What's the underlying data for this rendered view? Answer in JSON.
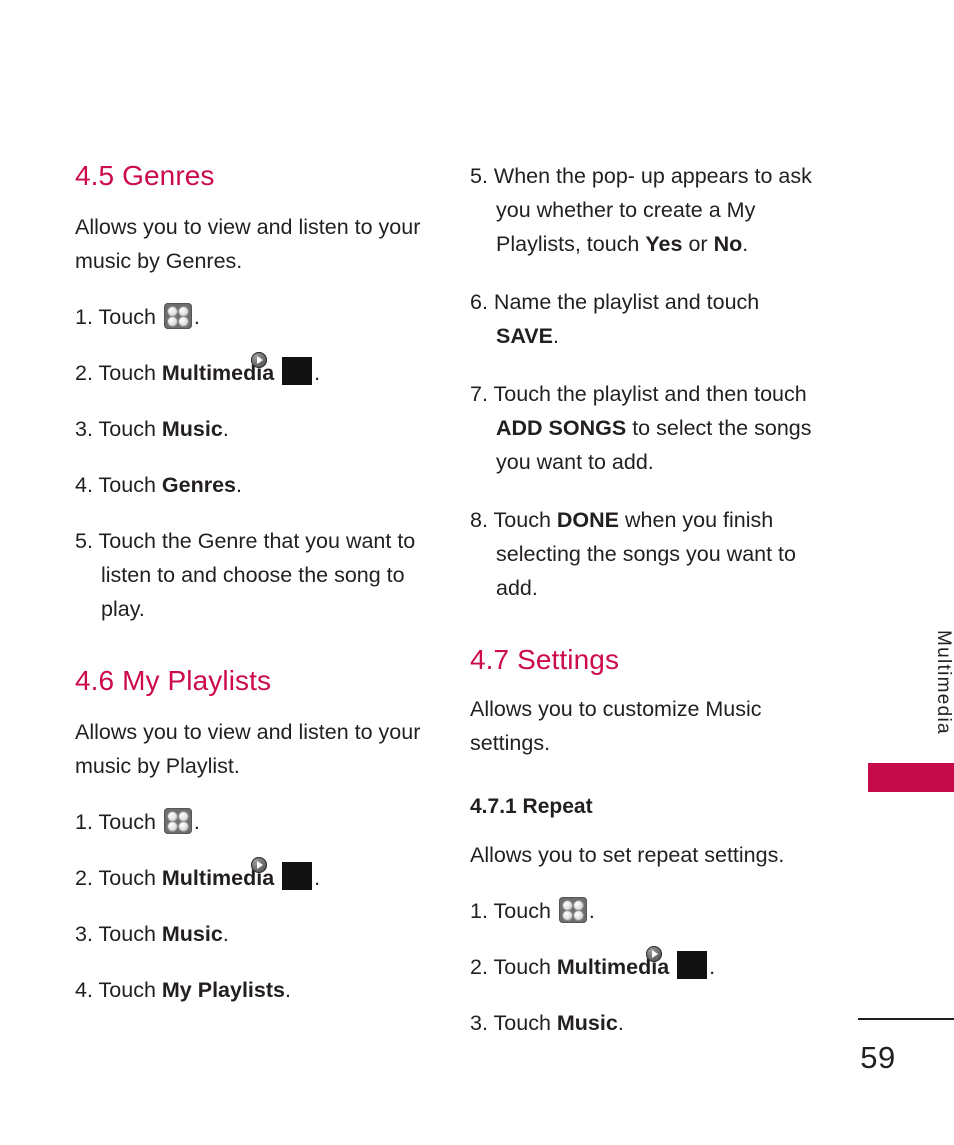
{
  "page": {
    "number": "59",
    "edge_tab_label": "Multimedia",
    "accent_color": "#cc0a4c",
    "tab_color": "#c60b4a",
    "text_color": "#231f20"
  },
  "icons": {
    "grid": "grid-menu-icon",
    "media": "multimedia-play-icon"
  },
  "left_column": {
    "section_genres": {
      "heading": "4.5 Genres",
      "intro": "Allows you to view and listen to your music by Genres.",
      "steps": [
        {
          "num": "1.",
          "pre": "Touch",
          "icon": "grid",
          "post": "."
        },
        {
          "num": "2.",
          "pre": "Touch",
          "bold": "Multimedia",
          "icon": "media",
          "post": "."
        },
        {
          "num": "3.",
          "pre": "Touch",
          "bold": "Music",
          "post": "."
        },
        {
          "num": "4.",
          "pre": "Touch",
          "bold": "Genres",
          "post": "."
        },
        {
          "num": "5.",
          "text": "Touch the Genre that you want to listen to and choose the song to play."
        }
      ]
    },
    "section_my_playlists": {
      "heading": "4.6 My Playlists",
      "intro": "Allows you to view and listen to your music by Playlist.",
      "steps": [
        {
          "num": "1.",
          "pre": "Touch",
          "icon": "grid",
          "post": "."
        },
        {
          "num": "2.",
          "pre": "Touch",
          "bold": "Multimedia",
          "icon": "media",
          "post": "."
        },
        {
          "num": "3.",
          "pre": "Touch",
          "bold": "Music",
          "post": "."
        },
        {
          "num": "4.",
          "pre": "Touch",
          "bold": "My Playlists",
          "post": "."
        }
      ]
    }
  },
  "right_column": {
    "continued_steps": [
      {
        "num": "5.",
        "pre": "When the pop- up appears to ask you whether to create a My Playlists, touch",
        "bold": "Yes",
        "mid": "or",
        "bold2": "No",
        "post": "."
      },
      {
        "num": "6.",
        "pre": "Name the playlist and touch",
        "bold": "SAVE",
        "post": "."
      },
      {
        "num": "7.",
        "pre": "Touch the playlist and then touch",
        "bold": "ADD SONGS",
        "post": "to select the songs you want to add."
      },
      {
        "num": "8.",
        "pre": "Touch",
        "bold": "DONE",
        "post": "when you finish selecting the songs you want to add."
      }
    ],
    "section_settings": {
      "heading": "4.7 Settings",
      "intro": "Allows you to customize Music settings.",
      "subsection": {
        "heading": "4.7.1 Repeat",
        "intro": "Allows you to set repeat settings.",
        "steps": [
          {
            "num": "1.",
            "pre": "Touch",
            "icon": "grid",
            "post": "."
          },
          {
            "num": "2.",
            "pre": "Touch",
            "bold": "Multimedia",
            "icon": "media",
            "post": "."
          },
          {
            "num": "3.",
            "pre": "Touch",
            "bold": "Music",
            "post": "."
          }
        ]
      }
    }
  }
}
